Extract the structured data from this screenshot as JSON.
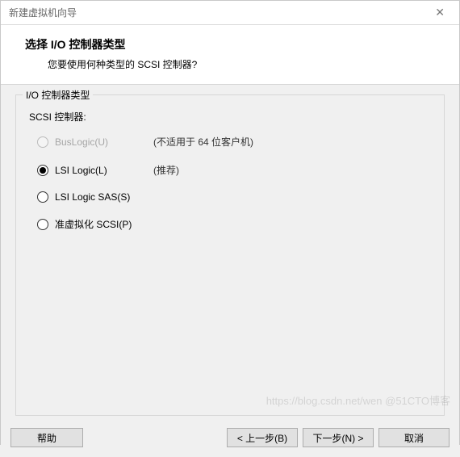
{
  "window": {
    "title": "新建虚拟机向导"
  },
  "header": {
    "title": "选择 I/O 控制器类型",
    "subtitle": "您要使用何种类型的 SCSI 控制器?"
  },
  "groupTitle": "I/O 控制器类型",
  "scsiLabel": "SCSI 控制器:",
  "options": {
    "buslogic": {
      "label": "BusLogic(U)",
      "note": "(不适用于 64 位客户机)",
      "selected": false,
      "disabled": true
    },
    "lsi": {
      "label": "LSI Logic(L)",
      "note": "(推荐)",
      "selected": true,
      "disabled": false
    },
    "lsisas": {
      "label": "LSI Logic SAS(S)",
      "note": "",
      "selected": false,
      "disabled": false
    },
    "paravirtual": {
      "label": "准虚拟化 SCSI(P)",
      "note": "",
      "selected": false,
      "disabled": false
    }
  },
  "buttons": {
    "help": "帮助",
    "back": "< 上一步(B)",
    "next": "下一步(N) >",
    "cancel": "取消"
  },
  "watermark": "https://blog.csdn.net/wen @51CTO博客"
}
